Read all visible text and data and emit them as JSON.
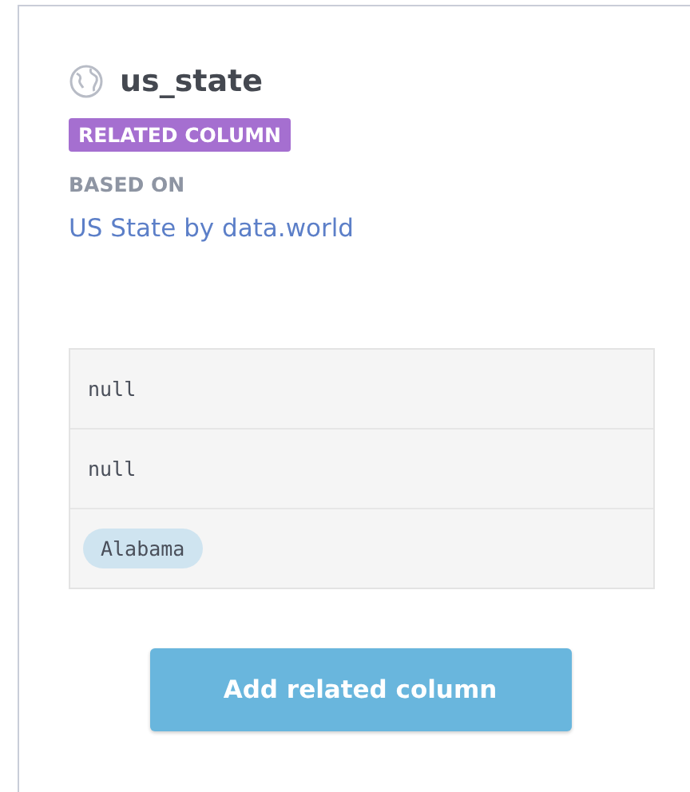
{
  "column": {
    "name": "us_state",
    "badge": "RELATED COLUMN",
    "based_on_label": "BASED ON",
    "source_link": "US State by data.world"
  },
  "values": [
    {
      "kind": "null",
      "text": "null"
    },
    {
      "kind": "null",
      "text": "null"
    },
    {
      "kind": "value",
      "text": "Alabama"
    }
  ],
  "button": "Add related column"
}
